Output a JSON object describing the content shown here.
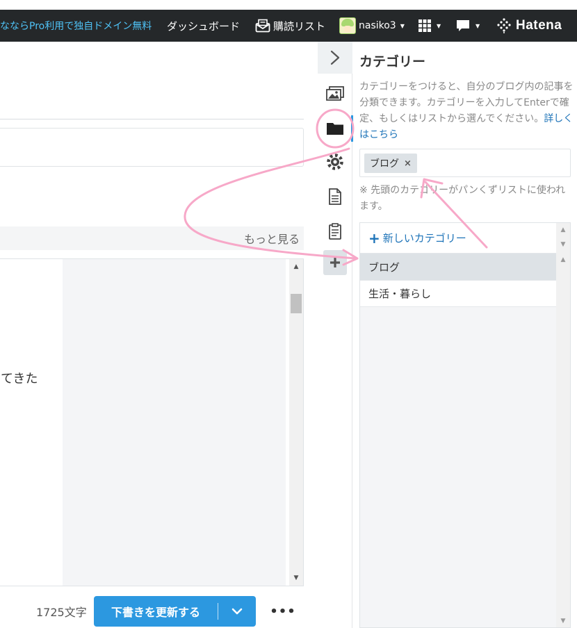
{
  "topbar": {
    "promo": "なならPro利用で独自ドメイン無料",
    "dashboard": "ダッシュボード",
    "subscriptions": "購読リスト",
    "username": "nasiko3",
    "brand": "Hatena"
  },
  "editor": {
    "more_link": "もっと見る",
    "visible_text": "てきた",
    "char_count": "1725文字",
    "save_label": "下書きを更新する",
    "more_dots": "•••"
  },
  "panel": {
    "title": "カテゴリー",
    "description": "カテゴリーをつけると、自分のブログ内の記事を分類できます。カテゴリーを入力してEnterで確定、もしくはリストから選んでください。",
    "details_link": "詳しくはこちら",
    "selected_tag": "ブログ",
    "tag_remove": "×",
    "note": "※ 先頭のカテゴリーがパンくずリストに使われます。",
    "new_category": "新しいカテゴリー",
    "categories": [
      "ブログ",
      "生活・暮らし"
    ]
  },
  "icons": {
    "rail": [
      "chevron-right-icon",
      "image-icon",
      "folder-icon",
      "gear-icon",
      "document-icon",
      "clipboard-icon",
      "plus-icon"
    ],
    "topbar": [
      "mail-icon",
      "grid-icon",
      "comment-icon",
      "hatena-logo"
    ]
  },
  "colors": {
    "topbar_bg": "#25282a",
    "promo": "#4fc3f7",
    "accent": "#2c98e0",
    "link": "#1d73b8",
    "annotation": "#f7a8c8"
  }
}
